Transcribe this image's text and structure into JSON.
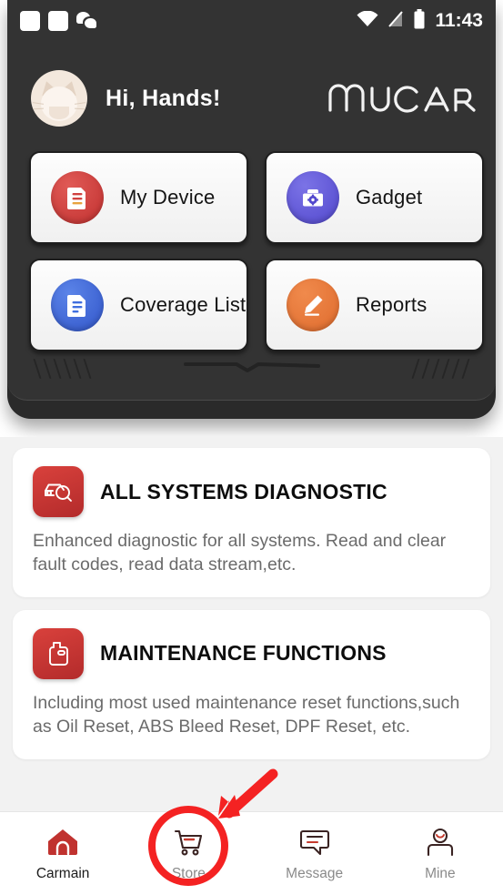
{
  "status_bar": {
    "time": "11:43",
    "left_icons": [
      "app-square-icon",
      "app-square-icon",
      "wechat-icon"
    ],
    "right_icons": [
      "wifi-icon",
      "signal-off-icon",
      "battery-icon"
    ]
  },
  "header": {
    "greeting": "Hi,  Hands!",
    "brand": "MUCAR",
    "avatar_icon": "cat-avatar"
  },
  "tiles": [
    {
      "label": "My Device",
      "icon": "device-icon",
      "color": "#d0413f"
    },
    {
      "label": "Gadget",
      "icon": "toolbox-icon",
      "color": "#6159d8"
    },
    {
      "label": "Coverage List",
      "icon": "document-icon",
      "color": "#3f6ede"
    },
    {
      "label": "Reports",
      "icon": "pencil-icon",
      "color": "#e8743a"
    }
  ],
  "cards": [
    {
      "title": "ALL SYSTEMS DIAGNOSTIC",
      "desc": "Enhanced diagnostic for all systems. Read and clear fault codes, read data stream,etc.",
      "icon": "car-scan-icon"
    },
    {
      "title": "MAINTENANCE FUNCTIONS",
      "desc": "Including most used maintenance reset functions,such as Oil Reset, ABS Bleed Reset, DPF Reset, etc.",
      "icon": "oil-can-icon"
    }
  ],
  "bottom_nav": {
    "items": [
      {
        "label": "Carmain",
        "icon": "home-icon",
        "active": true
      },
      {
        "label": "Store",
        "icon": "cart-icon",
        "active": false
      },
      {
        "label": "Message",
        "icon": "message-icon",
        "active": false
      },
      {
        "label": "Mine",
        "icon": "person-icon",
        "active": false
      }
    ]
  },
  "annotation": {
    "highlight_target": "Store",
    "shape": "circle-and-arrow",
    "color": "#f42222"
  },
  "colors": {
    "hero_bg": "#333333",
    "page_bg": "#f2f2f2",
    "accent_red": "#d0413f",
    "annotation_red": "#f42222"
  }
}
